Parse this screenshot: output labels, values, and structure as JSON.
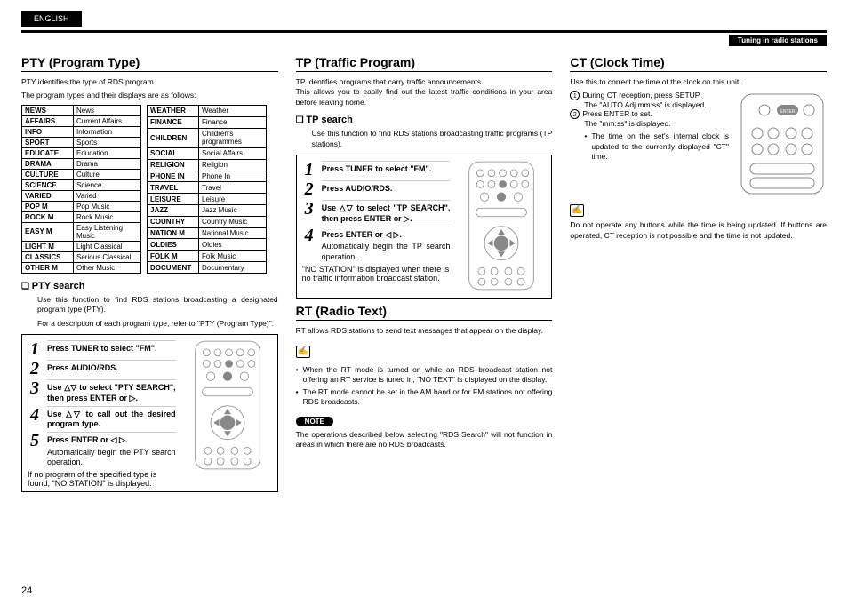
{
  "header": {
    "language": "ENGLISH",
    "chapter": "Tuning in radio stations"
  },
  "pageNumber": "24",
  "col1": {
    "title": "PTY (Program Type)",
    "intro1": "PTY identifies the type of RDS program.",
    "intro2": "The program types and their displays are as follows:",
    "tableA": [
      {
        "k": "NEWS",
        "v": "News"
      },
      {
        "k": "AFFAIRS",
        "v": "Current Affairs"
      },
      {
        "k": "INFO",
        "v": "Information"
      },
      {
        "k": "SPORT",
        "v": "Sports"
      },
      {
        "k": "EDUCATE",
        "v": "Education"
      },
      {
        "k": "DRAMA",
        "v": "Drama"
      },
      {
        "k": "CULTURE",
        "v": "Culture"
      },
      {
        "k": "SCIENCE",
        "v": "Science"
      },
      {
        "k": "VARIED",
        "v": "Varied"
      },
      {
        "k": "POP M",
        "v": "Pop Music"
      },
      {
        "k": "ROCK M",
        "v": "Rock Music"
      },
      {
        "k": "EASY M",
        "v": "Easy Listening Music"
      },
      {
        "k": "LIGHT M",
        "v": "Light Classical"
      },
      {
        "k": "CLASSICS",
        "v": "Serious Classical"
      },
      {
        "k": "OTHER M",
        "v": "Other Music"
      }
    ],
    "tableB": [
      {
        "k": "WEATHER",
        "v": "Weather"
      },
      {
        "k": "FINANCE",
        "v": "Finance"
      },
      {
        "k": "CHILDREN",
        "v": "Children's programmes"
      },
      {
        "k": "SOCIAL",
        "v": "Social Affairs"
      },
      {
        "k": "RELIGION",
        "v": "Religion"
      },
      {
        "k": "PHONE IN",
        "v": "Phone In"
      },
      {
        "k": "TRAVEL",
        "v": "Travel"
      },
      {
        "k": "LEISURE",
        "v": "Leisure"
      },
      {
        "k": "JAZZ",
        "v": "Jazz Music"
      },
      {
        "k": "COUNTRY",
        "v": "Country Music"
      },
      {
        "k": "NATION M",
        "v": "National Music"
      },
      {
        "k": "OLDIES",
        "v": "Oldies"
      },
      {
        "k": "FOLK M",
        "v": "Folk Music"
      },
      {
        "k": "DOCUMENT",
        "v": "Documentary"
      }
    ],
    "ptySearch": {
      "title": "PTY search",
      "p1": "Use this function to find RDS stations broadcasting a designated program type (PTY).",
      "p2": "For a description of each program type, refer to \"PTY (Program Type)\".",
      "steps": [
        "Press TUNER to select \"FM\".",
        "Press AUDIO/RDS.",
        "Use △▽ to select \"PTY SEARCH\", then press ENTER or ▷.",
        "Use △▽ to call out the desired program type.",
        "Press ENTER or ◁ ▷."
      ],
      "step5sub": "Automatically begin the PTY search operation.",
      "foot": "If no program of the specified type is found, \"NO STATION\" is displayed."
    }
  },
  "col2": {
    "tp": {
      "title": "TP (Traffic Program)",
      "intro": "TP identifies programs that carry traffic announcements.\nThis allows you to easily find out the latest traffic conditions in your area before leaving home.",
      "sub": "TP search",
      "subIntro": "Use this function to find RDS stations broadcasting traffic programs (TP stations).",
      "steps": [
        "Press TUNER to select \"FM\".",
        "Press AUDIO/RDS.",
        "Use △▽ to select \"TP SEARCH\", then press ENTER or ▷.",
        "Press ENTER or ◁ ▷."
      ],
      "step4sub": "Automatically begin the TP search operation.",
      "foot": "\"NO STATION\" is displayed when there is no traffic information broadcast station."
    },
    "rt": {
      "title": "RT (Radio Text)",
      "intro": "RT allows RDS stations to send text messages that appear on the display.",
      "bullets": [
        "When the RT mode is turned on while an RDS broadcast station not offering an RT service is tuned in, \"NO TEXT\" is displayed on the display.",
        "The RT mode cannot be set in the AM band or for FM stations not offering RDS broadcasts."
      ],
      "noteLabel": "NOTE",
      "noteText": "The operations described below selecting \"RDS Search\" will not function in areas in which there are no RDS broadcasts."
    }
  },
  "col3": {
    "title": "CT (Clock Time)",
    "intro": "Use this to correct the time of the clock on this unit.",
    "steps": [
      "During CT reception, press SETUP.",
      "Press ENTER to set."
    ],
    "sub1": "The \"AUTO Adj mm:ss\" is displayed.",
    "sub2": "The \"mm:ss\" is displayed.",
    "bullet": "The time on the set's internal clock is updated to the currently displayed \"CT\" time.",
    "warn": "Do not operate any buttons while the time is being updated. If buttons are operated, CT reception is not possible and the time is not updated."
  }
}
